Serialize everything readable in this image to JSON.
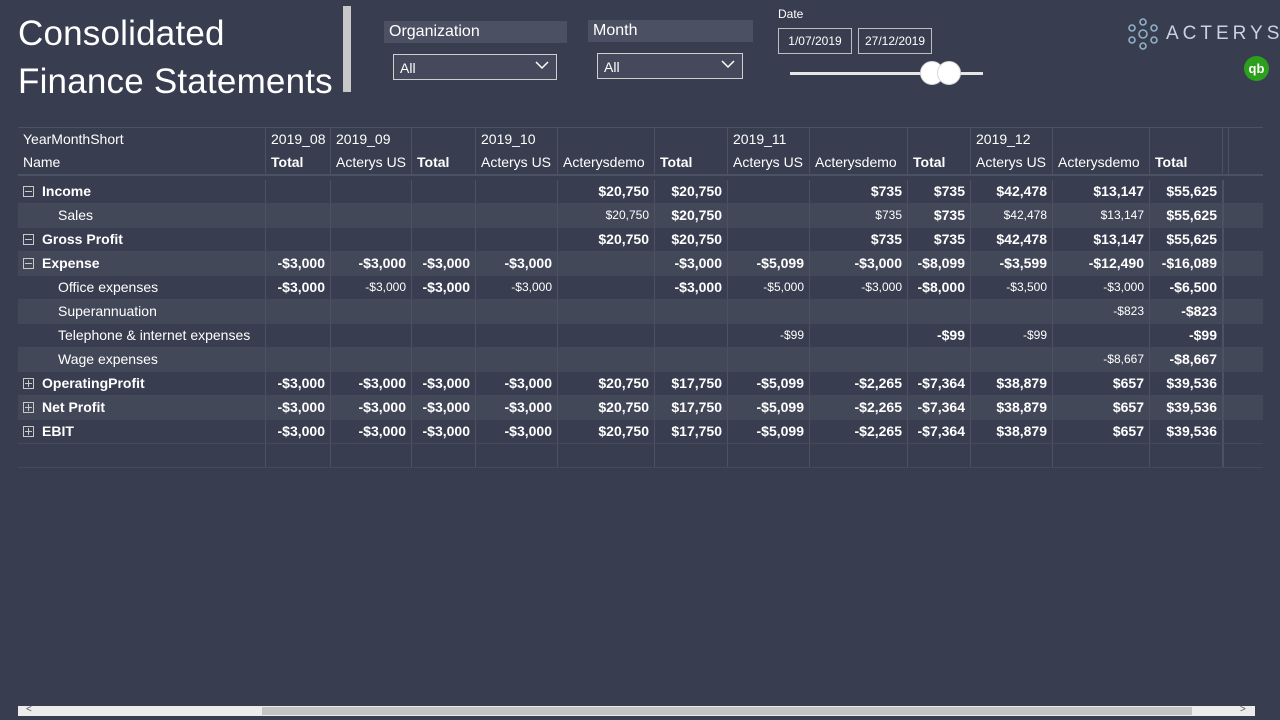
{
  "header": {
    "title_line1": "Consolidated",
    "title_line2": "Finance Statements"
  },
  "filters": {
    "organization": {
      "label": "Organization",
      "value": "All"
    },
    "month": {
      "label": "Month",
      "value": "All"
    },
    "date": {
      "label": "Date",
      "start": "1/07/2019",
      "end": "27/12/2019"
    }
  },
  "brand": {
    "logo_text": "ACTERYS",
    "qb_glyph": "qb"
  },
  "matrix": {
    "corner_top": "YearMonthShort",
    "corner_bottom": "Name",
    "months": [
      "2019_08",
      "2019_09",
      "2019_10",
      "2019_11",
      "2019_12"
    ],
    "subheaders": [
      "Total",
      "Acterys US",
      "Total",
      "Acterys US",
      "Acterysdemo",
      "Total",
      "Acterys US",
      "Acterysdemo",
      "Total",
      "Acterys US",
      "Acterysdemo",
      "Total"
    ],
    "rows": [
      {
        "name": "Income",
        "expand": "minus",
        "level": 0,
        "values": [
          "",
          "",
          "",
          "",
          "$20,750",
          "$20,750",
          "",
          "$735",
          "$735",
          "$42,478",
          "$13,147",
          "$55,625"
        ]
      },
      {
        "name": "Sales",
        "expand": "",
        "level": 1,
        "values": [
          "",
          "",
          "",
          "",
          "$20,750",
          "$20,750",
          "",
          "$735",
          "$735",
          "$42,478",
          "$13,147",
          "$55,625"
        ]
      },
      {
        "name": "Gross Profit",
        "expand": "minus",
        "level": 0,
        "values": [
          "",
          "",
          "",
          "",
          "$20,750",
          "$20,750",
          "",
          "$735",
          "$735",
          "$42,478",
          "$13,147",
          "$55,625"
        ]
      },
      {
        "name": "Expense",
        "expand": "minus",
        "level": 0,
        "values": [
          "-$3,000",
          "-$3,000",
          "-$3,000",
          "-$3,000",
          "",
          "-$3,000",
          "-$5,099",
          "-$3,000",
          "-$8,099",
          "-$3,599",
          "-$12,490",
          "-$16,089"
        ]
      },
      {
        "name": "Office expenses",
        "expand": "",
        "level": 1,
        "values": [
          "-$3,000",
          "-$3,000",
          "-$3,000",
          "-$3,000",
          "",
          "-$3,000",
          "-$5,000",
          "-$3,000",
          "-$8,000",
          "-$3,500",
          "-$3,000",
          "-$6,500"
        ]
      },
      {
        "name": "Superannuation",
        "expand": "",
        "level": 1,
        "values": [
          "",
          "",
          "",
          "",
          "",
          "",
          "",
          "",
          "",
          "",
          "-$823",
          "-$823"
        ]
      },
      {
        "name": "Telephone & internet expenses",
        "expand": "",
        "level": 1,
        "values": [
          "",
          "",
          "",
          "",
          "",
          "",
          "-$99",
          "",
          "-$99",
          "-$99",
          "",
          "-$99"
        ]
      },
      {
        "name": "Wage expenses",
        "expand": "",
        "level": 1,
        "values": [
          "",
          "",
          "",
          "",
          "",
          "",
          "",
          "",
          "",
          "",
          "-$8,667",
          "-$8,667"
        ]
      },
      {
        "name": "OperatingProfit",
        "expand": "plus",
        "level": 0,
        "values": [
          "-$3,000",
          "-$3,000",
          "-$3,000",
          "-$3,000",
          "$20,750",
          "$17,750",
          "-$5,099",
          "-$2,265",
          "-$7,364",
          "$38,879",
          "$657",
          "$39,536"
        ]
      },
      {
        "name": "Net Profit",
        "expand": "plus",
        "level": 0,
        "values": [
          "-$3,000",
          "-$3,000",
          "-$3,000",
          "-$3,000",
          "$20,750",
          "$17,750",
          "-$5,099",
          "-$2,265",
          "-$7,364",
          "$38,879",
          "$657",
          "$39,536"
        ]
      },
      {
        "name": "EBIT",
        "expand": "plus",
        "level": 0,
        "values": [
          "-$3,000",
          "-$3,000",
          "-$3,000",
          "-$3,000",
          "$20,750",
          "$17,750",
          "-$5,099",
          "-$2,265",
          "-$7,364",
          "$38,879",
          "$657",
          "$39,536"
        ]
      }
    ]
  },
  "scrollbar": {
    "left_arrow": "<",
    "right_arrow": ">"
  },
  "colors": {
    "background": "#383d4f",
    "slicer_header": "#4b5062",
    "logo_text": "#c9d4e0",
    "qb_green": "#2ca01c"
  }
}
